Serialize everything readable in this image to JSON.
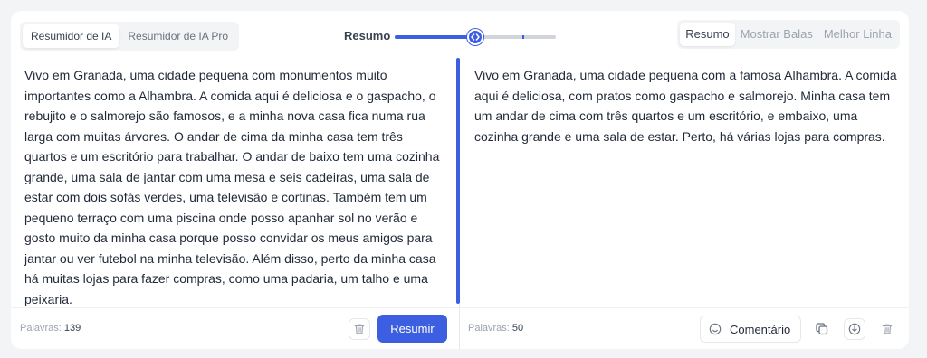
{
  "tabs": [
    {
      "label": "Resumidor de IA",
      "active": true
    },
    {
      "label": "Resumidor de IA Pro",
      "active": false
    }
  ],
  "length_slider": {
    "label": "Resumo",
    "value": 0.5
  },
  "modes": [
    {
      "label": "Resumo",
      "active": true
    },
    {
      "label": "Mostrar Balas",
      "active": false
    },
    {
      "label": "Melhor Linha",
      "active": false
    }
  ],
  "input": {
    "text": "Vivo em Granada, uma cidade pequena com monumentos muito importantes como a Alhambra. A comida aqui é deliciosa e o gaspacho, o rebujito e o salmorejo são famosos, e a minha nova casa fica numa rua larga com muitas árvores. O andar de cima da minha casa tem três quartos e um escritório para trabalhar. O andar de baixo tem uma cozinha grande, uma sala de jantar com uma mesa e seis cadeiras, uma sala de estar com dois sofás verdes, uma televisão e cortinas. Também tem um pequeno terraço com uma piscina onde posso apanhar sol no verão e gosto muito da minha casa porque posso convidar os meus amigos para jantar ou ver futebol na minha televisão. Além disso, perto da minha casa há muitas lojas para fazer compras, como uma padaria, um talho e uma peixaria.",
    "word_count_label": "Palavras:",
    "word_count": "139",
    "delete_icon": "trash-icon",
    "submit_label": "Resumir"
  },
  "output": {
    "text": "Vivo em Granada, uma cidade pequena com a famosa Alhambra. A comida aqui é deliciosa, com pratos como gaspacho e salmorejo. Minha casa tem um andar de cima com três quartos e um escritório, e embaixo, uma cozinha grande e uma sala de estar. Perto, há várias lojas para compras.",
    "word_count_label": "Palavras:",
    "word_count": "50",
    "comment_label": "Comentário",
    "comment_icon": "smiley-icon",
    "copy_icon": "copy-icon",
    "download_icon": "download-icon",
    "delete_icon": "trash-icon"
  },
  "colors": {
    "accent": "#3b5fe0",
    "background": "#f3f4f6"
  }
}
